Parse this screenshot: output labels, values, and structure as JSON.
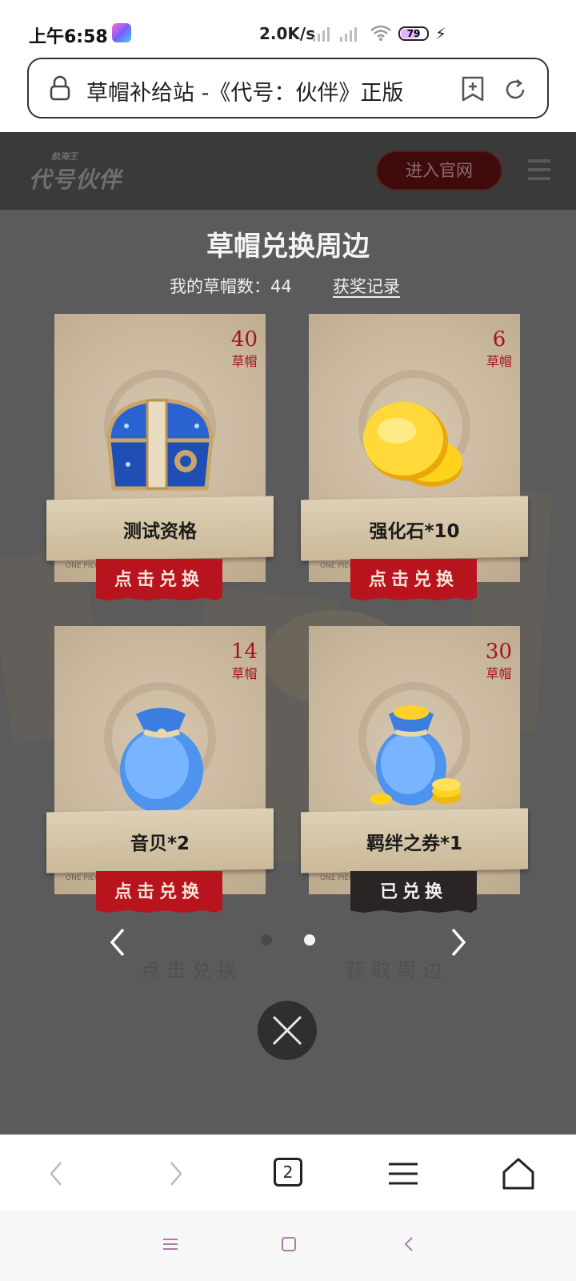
{
  "status_bar": {
    "time": "上午6:58",
    "network_speed": "2.0K/s",
    "battery": "79"
  },
  "address_bar": {
    "page_title": "草帽补给站 -《代号：伙伴》正版"
  },
  "site_header": {
    "logo_small": "航海王",
    "logo_text": "代号伙伴",
    "enter_button": "进入官网"
  },
  "exchange": {
    "title": "草帽兑换周边",
    "count_label": "我的草帽数：",
    "count_value": "44",
    "record_link": "获奖记录",
    "cost_unit": "草帽",
    "card_tiny_text": "ONE PIECE",
    "items": [
      {
        "name": "测试资格",
        "cost": "40",
        "button": "点击兑换",
        "icon": "treasure-chest"
      },
      {
        "name": "强化石*10",
        "cost": "6",
        "button": "点击兑换",
        "icon": "gold-coins"
      },
      {
        "name": "音贝*2",
        "cost": "14",
        "button": "点击兑换",
        "icon": "blue-bag"
      },
      {
        "name": "羁绊之券*1",
        "cost": "30",
        "button": "已兑换",
        "icon": "blue-bag-coins"
      }
    ]
  },
  "background_text": {
    "left": "点击兑换",
    "right": "获取周边"
  },
  "pager": {
    "total_pages": 2,
    "current_page": 2
  },
  "bottom_toolbar": {
    "tab_count": "2"
  },
  "colors": {
    "accent_red": "#b8141e",
    "done_dark": "#2b2424",
    "overlay": "#5b5b5b",
    "header": "#3a3a3a"
  }
}
